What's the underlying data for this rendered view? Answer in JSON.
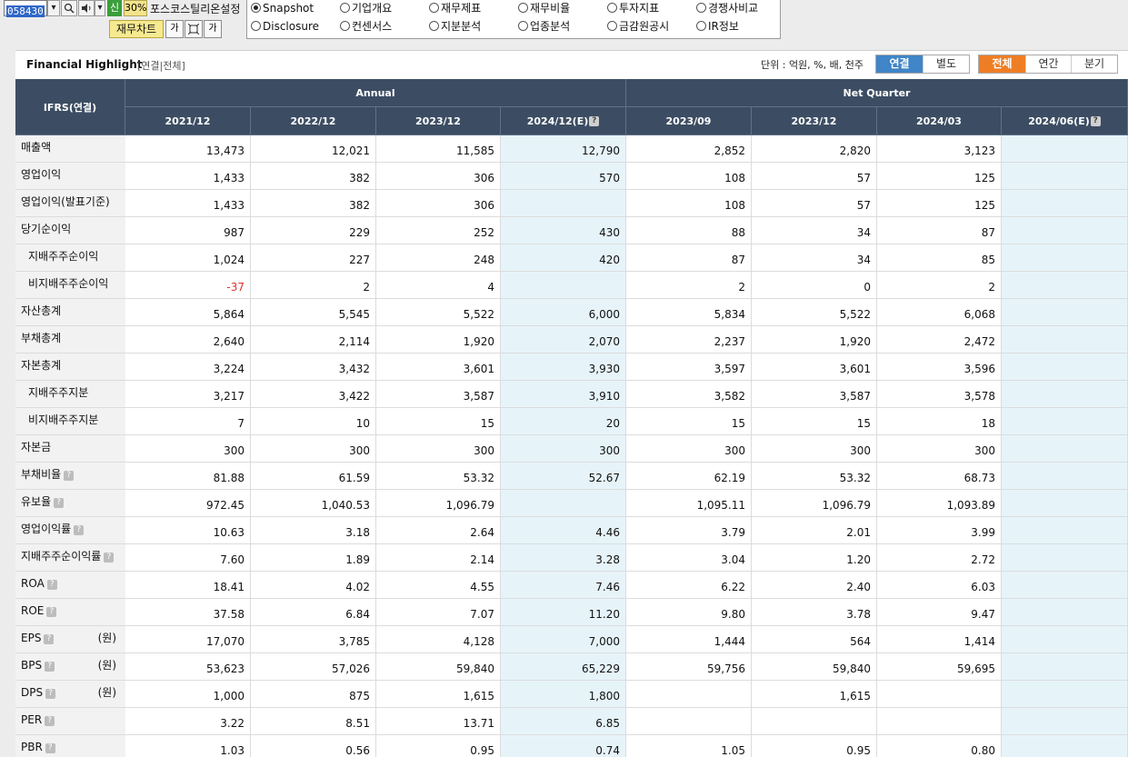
{
  "toolbar": {
    "code": "058430",
    "zoom": "30%",
    "company_name": "포스코스틸리온",
    "settings_label": "설정",
    "green_btn": "신",
    "chart_button": "재무차트",
    "font_btn": "가",
    "font_btn2": "가"
  },
  "menu": [
    {
      "label": "Snapshot",
      "selected": true
    },
    {
      "label": "기업개요",
      "selected": false
    },
    {
      "label": "재무제표",
      "selected": false
    },
    {
      "label": "재무비율",
      "selected": false
    },
    {
      "label": "투자지표",
      "selected": false
    },
    {
      "label": "경쟁사비교",
      "selected": false
    },
    {
      "label": "Disclosure",
      "selected": false
    },
    {
      "label": "컨센서스",
      "selected": false
    },
    {
      "label": "지분분석",
      "selected": false
    },
    {
      "label": "업종분석",
      "selected": false
    },
    {
      "label": "금감원공시",
      "selected": false
    },
    {
      "label": "IR정보",
      "selected": false
    }
  ],
  "header": {
    "title": "Financial Highlight",
    "subtitle": "[연결|전체]",
    "unit_text": "단위 : 억원, %, 배, 천주",
    "consolidation": [
      "연결",
      "별도"
    ],
    "period": [
      "전체",
      "연간",
      "분기"
    ]
  },
  "table": {
    "corner": "IFRS(연결)",
    "group_annual": "Annual",
    "group_quarter": "Net Quarter",
    "columns": [
      "2021/12",
      "2022/12",
      "2023/12",
      "2024/12(E)",
      "2023/09",
      "2023/12",
      "2024/03",
      "2024/06(E)"
    ],
    "q_mark": "?",
    "rows": [
      {
        "label": "매출액",
        "values": [
          "13,473",
          "12,021",
          "11,585",
          "12,790",
          "2,852",
          "2,820",
          "3,123",
          ""
        ]
      },
      {
        "label": "영업이익",
        "values": [
          "1,433",
          "382",
          "306",
          "570",
          "108",
          "57",
          "125",
          ""
        ]
      },
      {
        "label": "영업이익(발표기준)",
        "values": [
          "1,433",
          "382",
          "306",
          "",
          "108",
          "57",
          "125",
          ""
        ]
      },
      {
        "label": "당기순이익",
        "values": [
          "987",
          "229",
          "252",
          "430",
          "88",
          "34",
          "87",
          ""
        ]
      },
      {
        "label": "지배주주순이익",
        "indent": true,
        "values": [
          "1,024",
          "227",
          "248",
          "420",
          "87",
          "34",
          "85",
          ""
        ]
      },
      {
        "label": "비지배주주순이익",
        "indent": true,
        "values": [
          "-37",
          "2",
          "4",
          "",
          "2",
          "0",
          "2",
          ""
        ]
      },
      {
        "label": "자산총계",
        "values": [
          "5,864",
          "5,545",
          "5,522",
          "6,000",
          "5,834",
          "5,522",
          "6,068",
          ""
        ]
      },
      {
        "label": "부채총계",
        "values": [
          "2,640",
          "2,114",
          "1,920",
          "2,070",
          "2,237",
          "1,920",
          "2,472",
          ""
        ]
      },
      {
        "label": "자본총계",
        "values": [
          "3,224",
          "3,432",
          "3,601",
          "3,930",
          "3,597",
          "3,601",
          "3,596",
          ""
        ]
      },
      {
        "label": "지배주주지분",
        "indent": true,
        "values": [
          "3,217",
          "3,422",
          "3,587",
          "3,910",
          "3,582",
          "3,587",
          "3,578",
          ""
        ]
      },
      {
        "label": "비지배주주지분",
        "indent": true,
        "values": [
          "7",
          "10",
          "15",
          "20",
          "15",
          "15",
          "18",
          ""
        ]
      },
      {
        "label": "자본금",
        "values": [
          "300",
          "300",
          "300",
          "300",
          "300",
          "300",
          "300",
          ""
        ]
      },
      {
        "label": "부채비율",
        "help": true,
        "values": [
          "81.88",
          "61.59",
          "53.32",
          "52.67",
          "62.19",
          "53.32",
          "68.73",
          ""
        ]
      },
      {
        "label": "유보율",
        "help": true,
        "values": [
          "972.45",
          "1,040.53",
          "1,096.79",
          "",
          "1,095.11",
          "1,096.79",
          "1,093.89",
          ""
        ]
      },
      {
        "label": "영업이익률",
        "help": true,
        "values": [
          "10.63",
          "3.18",
          "2.64",
          "4.46",
          "3.79",
          "2.01",
          "3.99",
          ""
        ]
      },
      {
        "label": "지배주주순이익률",
        "help": true,
        "values": [
          "7.60",
          "1.89",
          "2.14",
          "3.28",
          "3.04",
          "1.20",
          "2.72",
          ""
        ]
      },
      {
        "label": "ROA",
        "help": true,
        "values": [
          "18.41",
          "4.02",
          "4.55",
          "7.46",
          "6.22",
          "2.40",
          "6.03",
          ""
        ]
      },
      {
        "label": "ROE",
        "help": true,
        "values": [
          "37.58",
          "6.84",
          "7.07",
          "11.20",
          "9.80",
          "3.78",
          "9.47",
          ""
        ]
      },
      {
        "label": "EPS",
        "help": true,
        "unit": "(원)",
        "values": [
          "17,070",
          "3,785",
          "4,128",
          "7,000",
          "1,444",
          "564",
          "1,414",
          ""
        ]
      },
      {
        "label": "BPS",
        "help": true,
        "unit": "(원)",
        "values": [
          "53,623",
          "57,026",
          "59,840",
          "65,229",
          "59,756",
          "59,840",
          "59,695",
          ""
        ]
      },
      {
        "label": "DPS",
        "help": true,
        "unit": "(원)",
        "values": [
          "1,000",
          "875",
          "1,615",
          "1,800",
          "",
          "1,615",
          "",
          ""
        ]
      },
      {
        "label": "PER",
        "help": true,
        "values": [
          "3.22",
          "8.51",
          "13.71",
          "6.85",
          "",
          "",
          "",
          ""
        ]
      },
      {
        "label": "PBR",
        "help": true,
        "values": [
          "1.03",
          "0.56",
          "0.95",
          "0.74",
          "1.05",
          "0.95",
          "0.80",
          ""
        ]
      }
    ]
  }
}
